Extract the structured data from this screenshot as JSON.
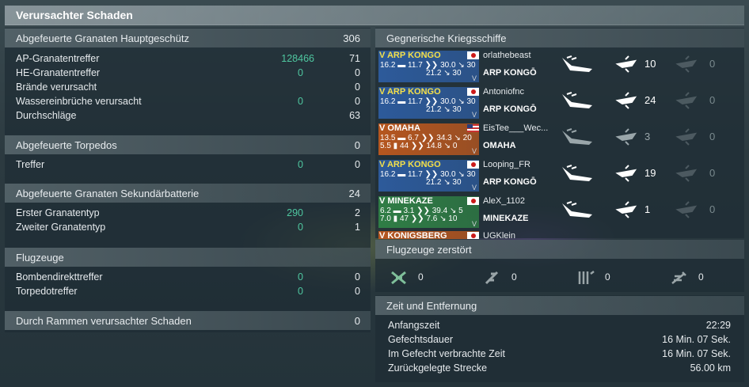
{
  "title": "Verursachter Schaden",
  "left": {
    "main_battery": {
      "header": "Abgefeuerte Granaten Hauptgeschütz",
      "total": "306",
      "rows": [
        {
          "label": "AP-Granatentreffer",
          "green": "128466",
          "value": "71"
        },
        {
          "label": "HE-Granatentreffer",
          "green": "0",
          "value": "0"
        },
        {
          "label": "Brände verursacht",
          "green": "",
          "value": "0"
        },
        {
          "label": "Wassereinbrüche verursacht",
          "green": "0",
          "value": "0"
        },
        {
          "label": "Durchschläge",
          "green": "",
          "value": "63"
        }
      ]
    },
    "torpedoes": {
      "header": "Abgefeuerte Torpedos",
      "total": "0",
      "rows": [
        {
          "label": "Treffer",
          "green": "0",
          "value": "0"
        }
      ]
    },
    "secondary": {
      "header": "Abgefeuerte Granaten Sekundärbatterie",
      "total": "24",
      "rows": [
        {
          "label": "Erster Granatentyp",
          "green": "290",
          "value": "2"
        },
        {
          "label": "Zweiter Granatentyp",
          "green": "0",
          "value": "1"
        }
      ]
    },
    "aircraft": {
      "header": "Flugzeuge",
      "total": "",
      "rows": [
        {
          "label": "Bombendirekttreffer",
          "green": "0",
          "value": "0"
        },
        {
          "label": "Torpedotreffer",
          "green": "0",
          "value": "0"
        }
      ]
    },
    "ramming": {
      "header": "Durch Rammen verursachter Schaden",
      "total": "0"
    }
  },
  "right": {
    "enemy_header": "Gegnerische Kriegsschiffe",
    "ships": [
      {
        "class": "V ARP KONGO",
        "s1a": "16.2",
        "s1b": "11.7",
        "s1c": "30.0",
        "s1d": "30",
        "s2a": "21.2",
        "s2b": "30",
        "player": "orlathebeast",
        "ship": "ARP KONGŌ",
        "flag": "jp",
        "color": "#2d5a9a",
        "name_color": "yellow",
        "c1": "10",
        "c2": "0",
        "active": true
      },
      {
        "class": "V ARP KONGO",
        "s1a": "16.2",
        "s1b": "11.7",
        "s1c": "30.0",
        "s1d": "30",
        "s2a": "21.2",
        "s2b": "30",
        "player": "Antoniofnc",
        "ship": "ARP KONGŌ",
        "flag": "jp",
        "color": "#2d5a9a",
        "name_color": "yellow",
        "c1": "24",
        "c2": "0",
        "active": true
      },
      {
        "class": "V OMAHA",
        "s1a": "13.5",
        "s1b": "6.7",
        "s1c": "34.3",
        "s1d": "20",
        "s2a": "5.5",
        "s2b": "44",
        "s2c": "14.8",
        "s2d": "0",
        "player": "EisTee___Wec...",
        "ship": "OMAHA",
        "flag": "us",
        "color": "#b5561f",
        "name_color": "white",
        "c1": "3",
        "c2": "0",
        "active": false
      },
      {
        "class": "V ARP KONGO",
        "s1a": "16.2",
        "s1b": "11.7",
        "s1c": "30.0",
        "s1d": "30",
        "s2a": "21.2",
        "s2b": "30",
        "player": "Looping_FR",
        "ship": "ARP KONGŌ",
        "flag": "jp",
        "color": "#2d5a9a",
        "name_color": "yellow",
        "c1": "19",
        "c2": "0",
        "active": true
      },
      {
        "class": "V MINEKAZE",
        "s1a": "6.2",
        "s1b": "3.1",
        "s1c": "39.4",
        "s1d": "5",
        "s2a": "7.0",
        "s2b": "47",
        "s2c": "7.6",
        "s2d": "10",
        "player": "AleX_1102",
        "ship": "MINEKAZE",
        "flag": "jp",
        "color": "#2f7d45",
        "name_color": "white",
        "c1": "1",
        "c2": "0",
        "active": true
      },
      {
        "class": "V KONIGSBERG",
        "player": "UGKlein",
        "color": "#b5561f",
        "name_color": "white"
      }
    ],
    "planes_header": "Flugzeuge zerstört",
    "planes": [
      {
        "icon": "fighter-icon",
        "value": "0"
      },
      {
        "icon": "bomber-icon",
        "value": "0"
      },
      {
        "icon": "torpedo-bomber-icon",
        "value": "0"
      },
      {
        "icon": "dive-bomber-icon",
        "value": "0"
      }
    ],
    "time_header": "Zeit und Entfernung",
    "time_rows": [
      {
        "label": "Anfangszeit",
        "value": "22:29"
      },
      {
        "label": "Gefechtsdauer",
        "value": "16 Min. 07 Sek."
      },
      {
        "label": "Im Gefecht verbrachte Zeit",
        "value": "16 Min. 07 Sek."
      },
      {
        "label": "Zurückgelegte Strecke",
        "value": "56.00 km"
      }
    ]
  }
}
